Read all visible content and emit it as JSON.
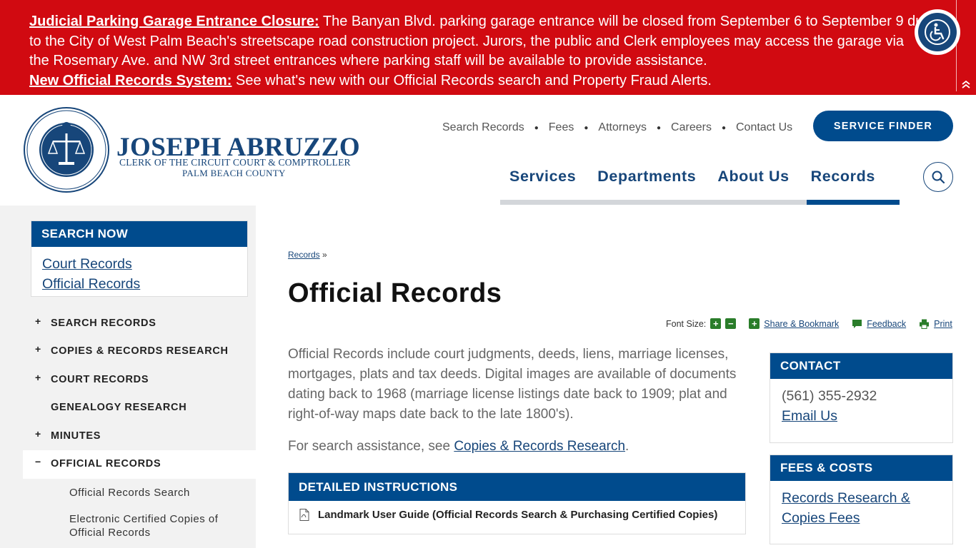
{
  "alert": {
    "items": [
      {
        "lead": "Judicial Parking Garage Entrance Closure:",
        "line1": " The Banyan Blvd. parking garage entrance will be closed from September 6 to September 9 due",
        "line2": "to the City of West Palm Beach's streetscape road construction project. Jurors, the public and Clerk employees may access the garage via",
        "line3": "the Rosemary Ave. and NW 3rd street entrances where parking staff will be available to provide assistance."
      },
      {
        "lead": "New Official Records System:",
        "line1": " See what's new with our Official Records search and Property Fraud Alerts."
      }
    ]
  },
  "logo": {
    "name": "JOSEPH ABRUZZO",
    "subtitle1": "CLERK OF THE CIRCUIT COURT & COMPTROLLER",
    "subtitle2": "PALM BEACH COUNTY"
  },
  "util_nav": [
    "Search Records",
    "Fees",
    "Attorneys",
    "Careers",
    "Contact Us"
  ],
  "service_finder": "SERVICE FINDER",
  "main_nav": [
    "Services",
    "Departments",
    "About Us",
    "Records"
  ],
  "sidebar": {
    "search_now": {
      "title": "SEARCH NOW",
      "links": [
        "Court Records",
        "Official Records"
      ]
    },
    "items": [
      {
        "label": "SEARCH RECORDS",
        "marker": "+"
      },
      {
        "label": "COPIES & RECORDS RESEARCH",
        "marker": "+"
      },
      {
        "label": "COURT RECORDS",
        "marker": "+"
      },
      {
        "label": "GENEALOGY RESEARCH",
        "marker": ""
      },
      {
        "label": "MINUTES",
        "marker": "+"
      },
      {
        "label": "OFFICIAL RECORDS",
        "marker": "−"
      }
    ],
    "subitems": [
      "Official Records Search",
      "Electronic Certified Copies of Official Records"
    ]
  },
  "breadcrumb": {
    "link": "Records",
    "sep": " »"
  },
  "page_title": "Official Records",
  "tools": {
    "font_size_label": "Font Size:",
    "share": "Share & Bookmark",
    "feedback": "Feedback",
    "print": "Print"
  },
  "intro": "Official Records include court judgments, deeds, liens, marriage licenses, mortgages, plats and tax deeds. Digital images are available of documents dating back to 1968 (marriage license listings date back to 1909; plat and right-of-way maps date back to the late 1800's).",
  "assist": {
    "prefix": "For search assistance, see ",
    "link": "Copies & Records Research",
    "suffix": "."
  },
  "instructions": {
    "title": "DETAILED INSTRUCTIONS",
    "doc": "Landmark User Guide (Official Records Search & Purchasing Certified Copies)"
  },
  "contact": {
    "title": "CONTACT",
    "phone": "(561) 355-2932",
    "email": "Email Us"
  },
  "fees": {
    "title": "FEES & COSTS",
    "link1": "Records Research &",
    "link2": "Copies Fees"
  },
  "colors": {
    "alert": "#d10a11",
    "brand": "#004b8d",
    "navy": "#17467a"
  }
}
